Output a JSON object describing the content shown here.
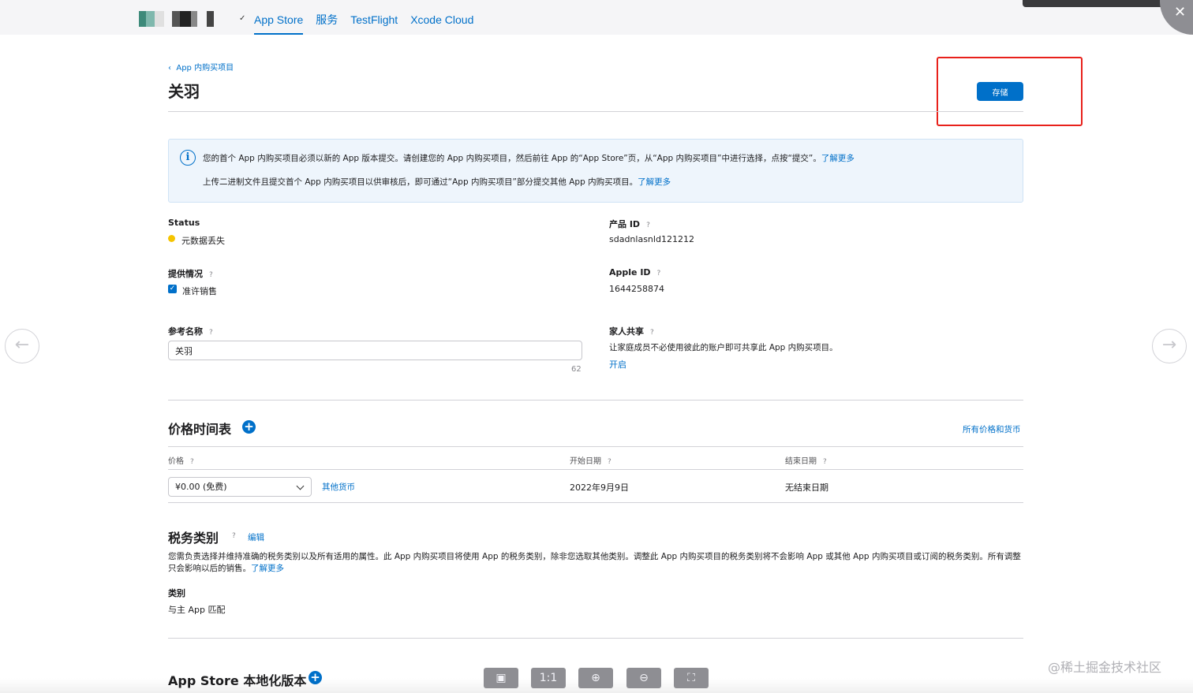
{
  "nav": {
    "tabs": [
      {
        "label": "App Store",
        "active": true
      },
      {
        "label": "服务"
      },
      {
        "label": "TestFlight"
      },
      {
        "label": "Xcode Cloud"
      }
    ]
  },
  "header": {
    "back_link": "App 内购买项目",
    "title": "关羽",
    "save_label": "存储"
  },
  "info": {
    "line1_text": "您的首个 App 内购买项目必须以新的 App 版本提交。请创建您的 App 内购买项目，然后前往 App 的“App Store”页，从“App 内购买项目”中进行选择，点按“提交”。",
    "line1_link": "了解更多",
    "line2_text": "上传二进制文件且提交首个 App 内购买项目以供审核后，即可通过“App 内购买项目”部分提交其他 App 内购买项目。",
    "line2_link": "了解更多"
  },
  "fields": {
    "status_label": "Status",
    "status_value": "元数据丢失",
    "availability_label": "提供情况",
    "availability_value": "准许销售",
    "ref_name_label": "参考名称",
    "ref_name_value": "关羽",
    "ref_name_count": "62",
    "product_id_label": "产品 ID",
    "product_id_value": "sdadnlasnld121212",
    "apple_id_label": "Apple ID",
    "apple_id_value": "1644258874",
    "family_label": "家人共享",
    "family_desc": "让家庭成员不必使用彼此的账户即可共享此 App 内购买项目。",
    "family_link": "开启"
  },
  "pricing": {
    "title": "价格时间表",
    "all_prices_link": "所有价格和货币",
    "col_price": "价格",
    "col_start": "开始日期",
    "col_end": "结束日期",
    "price_value": "¥0.00 (免费)",
    "other_currency_link": "其他货币",
    "start_value": "2022年9月9日",
    "end_value": "无结束日期"
  },
  "tax": {
    "title": "税务类别",
    "edit_link": "编辑",
    "desc": "您需负责选择并维持准确的税务类别以及所有适用的属性。此 App 内购买项目将使用 App 的税务类别，除非您选取其他类别。调整此 App 内购买项目的税务类别将不会影响 App 或其他 App 内购买项目或订阅的税务类别。所有调整只会影响以后的销售。",
    "learn_more": "了解更多",
    "category_label": "类别",
    "category_value": "与主 App 匹配"
  },
  "localization": {
    "title": "App Store 本地化版本"
  },
  "viewer": {
    "one_to_one": "1:1",
    "zoom_in": "⊕",
    "zoom_out": "⊖",
    "fit": "⛶",
    "watermark": "@稀土掘金技术社区"
  },
  "colors": {
    "accent": "#0070c9",
    "status_warning": "#f5c400",
    "annotation_red": "#e8211b"
  }
}
